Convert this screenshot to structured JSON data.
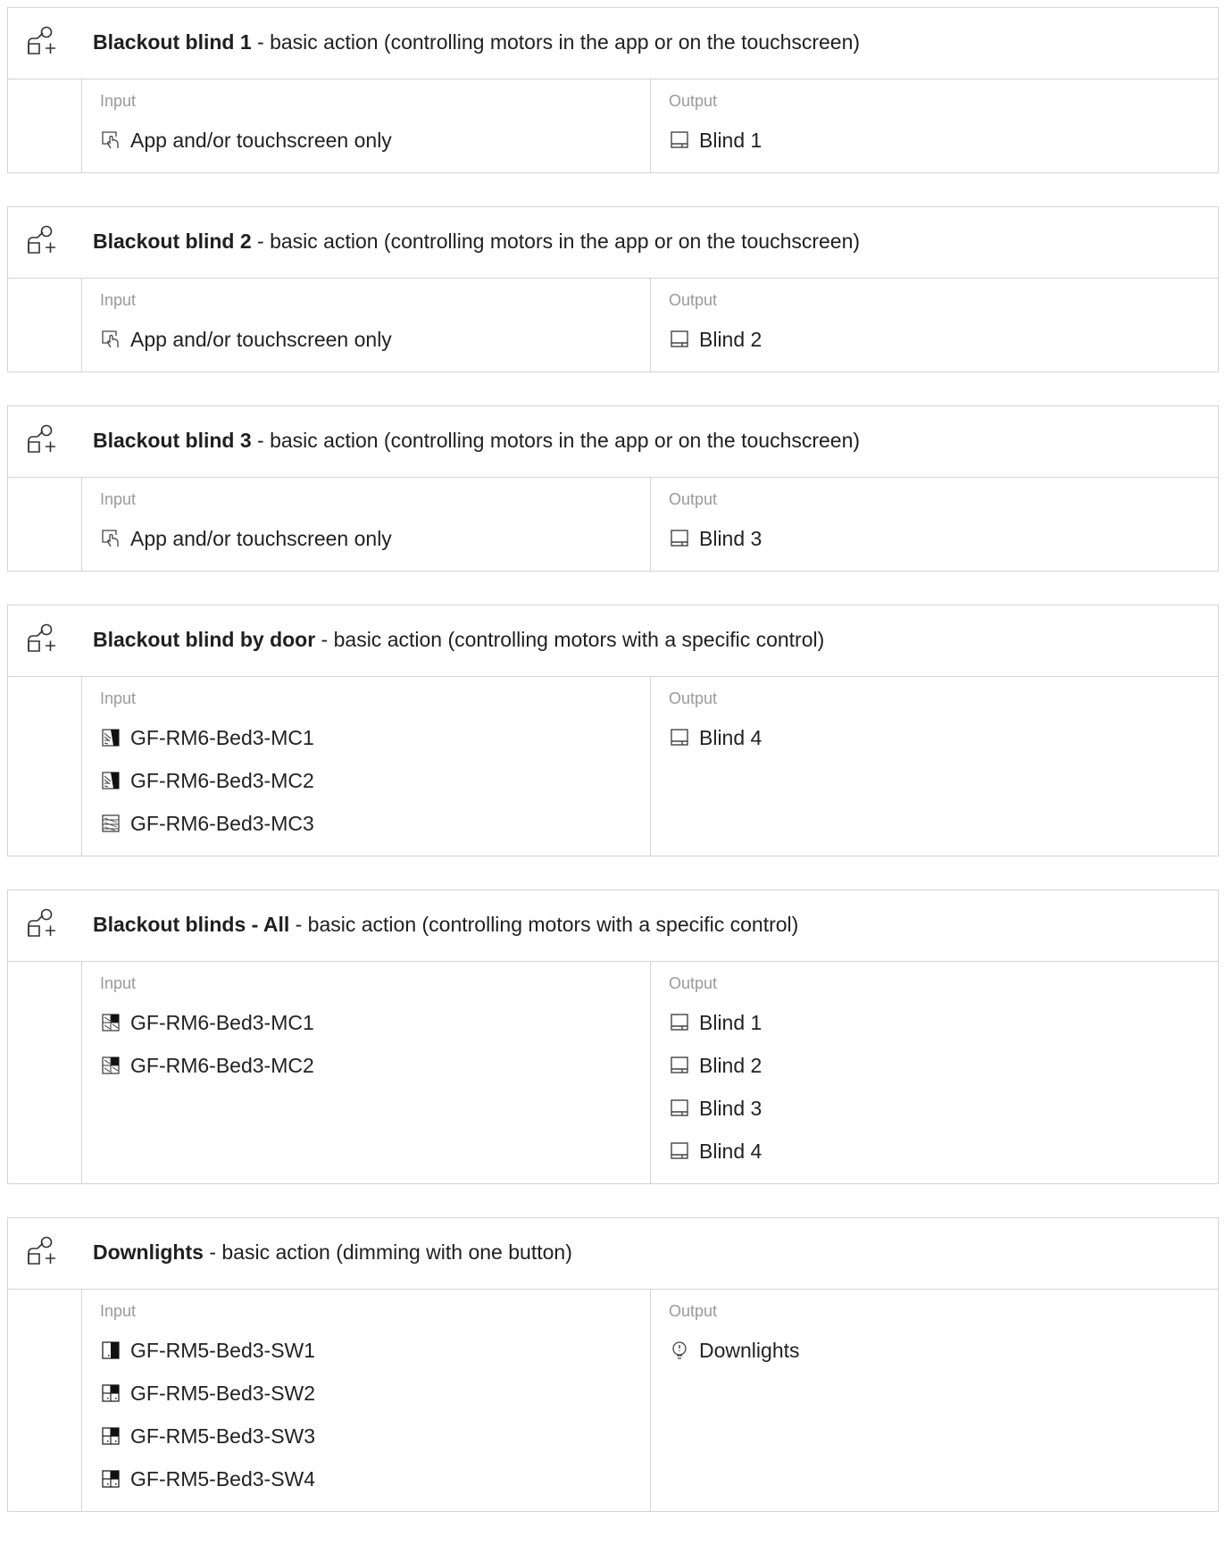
{
  "labels": {
    "input": "Input",
    "output": "Output"
  },
  "actions": [
    {
      "name": "Blackout blind 1",
      "description": " - basic action (controlling motors in the app or on the touchscreen)",
      "inputs": [
        {
          "label": "App and/or touchscreen only",
          "icon": "touch-screen-icon"
        }
      ],
      "outputs": [
        {
          "label": "Blind 1",
          "icon": "blind-icon"
        }
      ]
    },
    {
      "name": "Blackout blind 2",
      "description": " - basic action (controlling motors in the app or on the touchscreen)",
      "inputs": [
        {
          "label": "App and/or touchscreen only",
          "icon": "touch-screen-icon"
        }
      ],
      "outputs": [
        {
          "label": "Blind 2",
          "icon": "blind-icon"
        }
      ]
    },
    {
      "name": "Blackout blind 3",
      "description": " - basic action (controlling motors in the app or on the touchscreen)",
      "inputs": [
        {
          "label": "App and/or touchscreen only",
          "icon": "touch-screen-icon"
        }
      ],
      "outputs": [
        {
          "label": "Blind 3",
          "icon": "blind-icon"
        }
      ]
    },
    {
      "name": "Blackout blind by door",
      "description": " - basic action (controlling motors with a specific control)",
      "inputs": [
        {
          "label": "GF-RM6-Bed3-MC1",
          "icon": "motor-control-active-icon"
        },
        {
          "label": "GF-RM6-Bed3-MC2",
          "icon": "motor-control-active-icon"
        },
        {
          "label": "GF-RM6-Bed3-MC3",
          "icon": "motor-control-icon"
        }
      ],
      "outputs": [
        {
          "label": "Blind 4",
          "icon": "blind-icon"
        }
      ]
    },
    {
      "name": "Blackout blinds - All",
      "description": " - basic action (controlling motors with a specific control)",
      "inputs": [
        {
          "label": "GF-RM6-Bed3-MC1",
          "icon": "motor-control-half-icon"
        },
        {
          "label": "GF-RM6-Bed3-MC2",
          "icon": "motor-control-half-icon"
        }
      ],
      "outputs": [
        {
          "label": "Blind 1",
          "icon": "blind-icon"
        },
        {
          "label": "Blind 2",
          "icon": "blind-icon"
        },
        {
          "label": "Blind 3",
          "icon": "blind-icon"
        },
        {
          "label": "Blind 4",
          "icon": "blind-icon"
        }
      ]
    },
    {
      "name": "Downlights",
      "description": " - basic action (dimming with one button)",
      "inputs": [
        {
          "label": "GF-RM5-Bed3-SW1",
          "icon": "switch-single-icon"
        },
        {
          "label": "GF-RM5-Bed3-SW2",
          "icon": "switch-quad-icon"
        },
        {
          "label": "GF-RM5-Bed3-SW3",
          "icon": "switch-quad-icon"
        },
        {
          "label": "GF-RM5-Bed3-SW4",
          "icon": "switch-quad-icon"
        }
      ],
      "outputs": [
        {
          "label": "Downlights",
          "icon": "bulb-icon"
        }
      ]
    }
  ]
}
